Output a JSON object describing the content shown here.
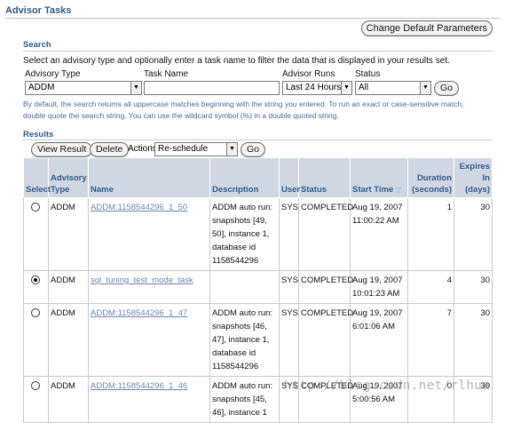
{
  "page": {
    "title": "Advisor Tasks"
  },
  "header": {
    "change_defaults_label": "Change Default Parameters"
  },
  "search": {
    "title": "Search",
    "instructions": "Select an advisory type and optionally enter a task name to filter the data that is displayed in your results set.",
    "advisory_type_label": "Advisory Type",
    "advisory_type_value": "ADDM",
    "task_name_label": "Task Name",
    "task_name_value": "",
    "advisor_runs_label": "Advisor Runs",
    "advisor_runs_value": "Last 24 Hours",
    "status_label": "Status",
    "status_value": "All",
    "go_label": "Go",
    "hint": "By default, the search returns all uppercase matches beginning with the string you entered. To run an exact or case-sensitive match, double quote the search string. You can use the wildcard symbol (%) in a double quoted string."
  },
  "results": {
    "title": "Results",
    "view_result_label": "View Result",
    "delete_label": "Delete",
    "actions_label": "Actions",
    "actions_value": "Re-schedule",
    "go_label": "Go",
    "columns": {
      "select": "Select",
      "advisory_type": "Advisory Type",
      "name": "Name",
      "description": "Description",
      "user": "User",
      "status": "Status",
      "start_time": "Start Time",
      "duration": "Duration (seconds)",
      "expires": "Expires In (days)"
    },
    "rows": [
      {
        "selected": false,
        "type": "ADDM",
        "name": "ADDM:1158544296_1_50",
        "description": "ADDM auto run: snapshots [49, 50], instance 1, database id 1158544296",
        "user": "SYS",
        "status": "COMPLETED",
        "start": "Aug 19, 2007 11:00:22 AM",
        "duration": "1",
        "expires": "30"
      },
      {
        "selected": true,
        "type": "ADDM",
        "name": "sql_tuning_test_mode_task",
        "description": "",
        "user": "SYS",
        "status": "COMPLETED",
        "start": "Aug 19, 2007 10:01:23 AM",
        "duration": "4",
        "expires": "30"
      },
      {
        "selected": false,
        "type": "ADDM",
        "name": "ADDM:1158544296_1_47",
        "description": "ADDM auto run: snapshots [46, 47], instance 1, database id 1158544296",
        "user": "SYS",
        "status": "COMPLETED",
        "start": "Aug 19, 2007 6:01:06 AM",
        "duration": "7",
        "expires": "30"
      },
      {
        "selected": false,
        "type": "ADDM",
        "name": "ADDM:1158544296_1_46",
        "description": "ADDM auto run: snapshots [45, 46], instance 1",
        "user": "SYS",
        "status": "COMPLETED",
        "start": "Aug 19, 2007 5:00:56 AM",
        "duration": "0",
        "expires": "30"
      }
    ]
  },
  "watermark": "http://blog.csdn.net/rlhua",
  "icons": {
    "dropdown": "chevron-down-icon",
    "sort": "sort-descending-icon",
    "radio": "radio-icon"
  }
}
